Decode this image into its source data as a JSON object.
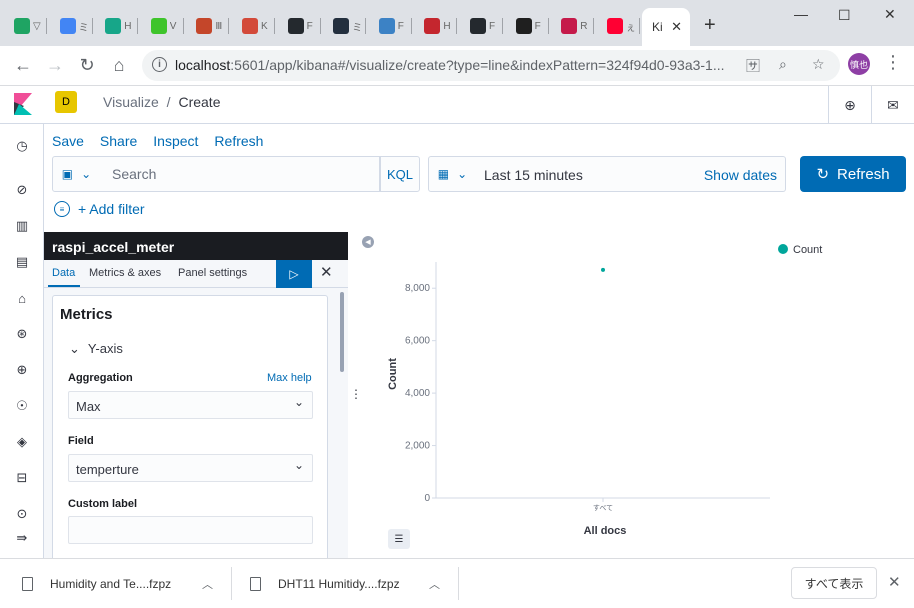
{
  "browser": {
    "tabs": [
      {
        "icon": "google-drive-icon",
        "text": "▽",
        "color": "#1fa463"
      },
      {
        "icon": "google-icon",
        "text": "ミ",
        "color": "#4285f4"
      },
      {
        "icon": "app-icon",
        "text": "H",
        "color": "#17a689"
      },
      {
        "icon": "circle-app-icon",
        "text": "V",
        "color": "#3ec42b"
      },
      {
        "icon": "app-icon",
        "text": "Ⅲ",
        "color": "#c4462a"
      },
      {
        "icon": "app-icon",
        "text": "K",
        "color": "#d34a3a"
      },
      {
        "icon": "github-icon",
        "text": "F",
        "color": "#24292e"
      },
      {
        "icon": "amazon-icon",
        "text": "ミ",
        "color": "#232f3e"
      },
      {
        "icon": "app-icon",
        "text": "F",
        "color": "#3c82c5"
      },
      {
        "icon": "app-icon",
        "text": "H",
        "color": "#c4262e"
      },
      {
        "icon": "github-icon",
        "text": "F",
        "color": "#24292e"
      },
      {
        "icon": "app-icon",
        "text": "F",
        "color": "#1f1f1f"
      },
      {
        "icon": "raspberry-icon",
        "text": "R",
        "color": "#c51a4a"
      },
      {
        "icon": "yahoo-icon",
        "text": "ぇ",
        "color": "#ff0033"
      }
    ],
    "active_tab": "Ki",
    "url_host": "localhost",
    "url_path": ":5601/app/kibana#/visualize/create?type=line&indexPattern=324f94d0-93a3-1...",
    "profile_label": "慎也"
  },
  "kibana": {
    "space_initial": "D",
    "breadcrumb_root": "Visualize",
    "breadcrumb_sep": "/",
    "breadcrumb_current": "Create",
    "top_menu": [
      "Save",
      "Share",
      "Inspect",
      "Refresh"
    ],
    "search_placeholder": "Search",
    "kql_label": "KQL",
    "date_range": "Last 15 minutes",
    "show_dates": "Show dates",
    "refresh_button": "Refresh",
    "add_filter": "+ Add filter"
  },
  "sidebar": {
    "title": "raspi_accel_meter",
    "tabs": [
      "Data",
      "Metrics & axes",
      "Panel settings"
    ],
    "metrics_title": "Metrics",
    "yaxis_label": "Y-axis",
    "aggregation_label": "Aggregation",
    "max_help": "Max help",
    "aggregation_value": "Max",
    "field_label": "Field",
    "field_value": "temperture",
    "custom_label": "Custom label",
    "custom_value": ""
  },
  "chart_data": {
    "type": "scatter",
    "categories": [
      "All docs"
    ],
    "series": [
      {
        "name": "Count",
        "values": [
          8700
        ]
      }
    ],
    "xlabel": "All docs",
    "ylabel": "Count",
    "x_tick_label": "すべて",
    "ylim": [
      0,
      9000
    ],
    "yticks": [
      "0",
      "2,000",
      "4,000",
      "6,000",
      "8,000"
    ],
    "ytick_values": [
      0,
      2000,
      4000,
      6000,
      8000
    ],
    "legend": "top-right",
    "series_color": "#00a69b",
    "grid": false
  },
  "downloads": {
    "items": [
      "Humidity and Te....fzpz",
      "DHT11 Humitidy....fzpz"
    ],
    "show_all": "すべて表示"
  }
}
